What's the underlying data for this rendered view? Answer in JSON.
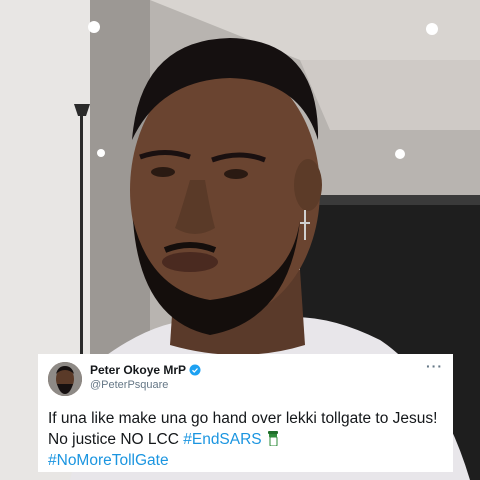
{
  "tweet": {
    "display_name": "Peter Okoye MrP",
    "handle": "@PeterPsquare",
    "text_part1": "If una like make una go hand over lekki tollgate to Jesus! No justice NO LCC ",
    "hashtag1": "#EndSARS",
    "hashtag2": "#NoMoreTollGate",
    "more_icon": "more-horizontal-icon",
    "verified_icon": "verified-badge-icon",
    "emoji": "raised-fist-green-icon"
  },
  "colors": {
    "hashtag": "#1b95e0",
    "verified": "#1da1f2"
  }
}
